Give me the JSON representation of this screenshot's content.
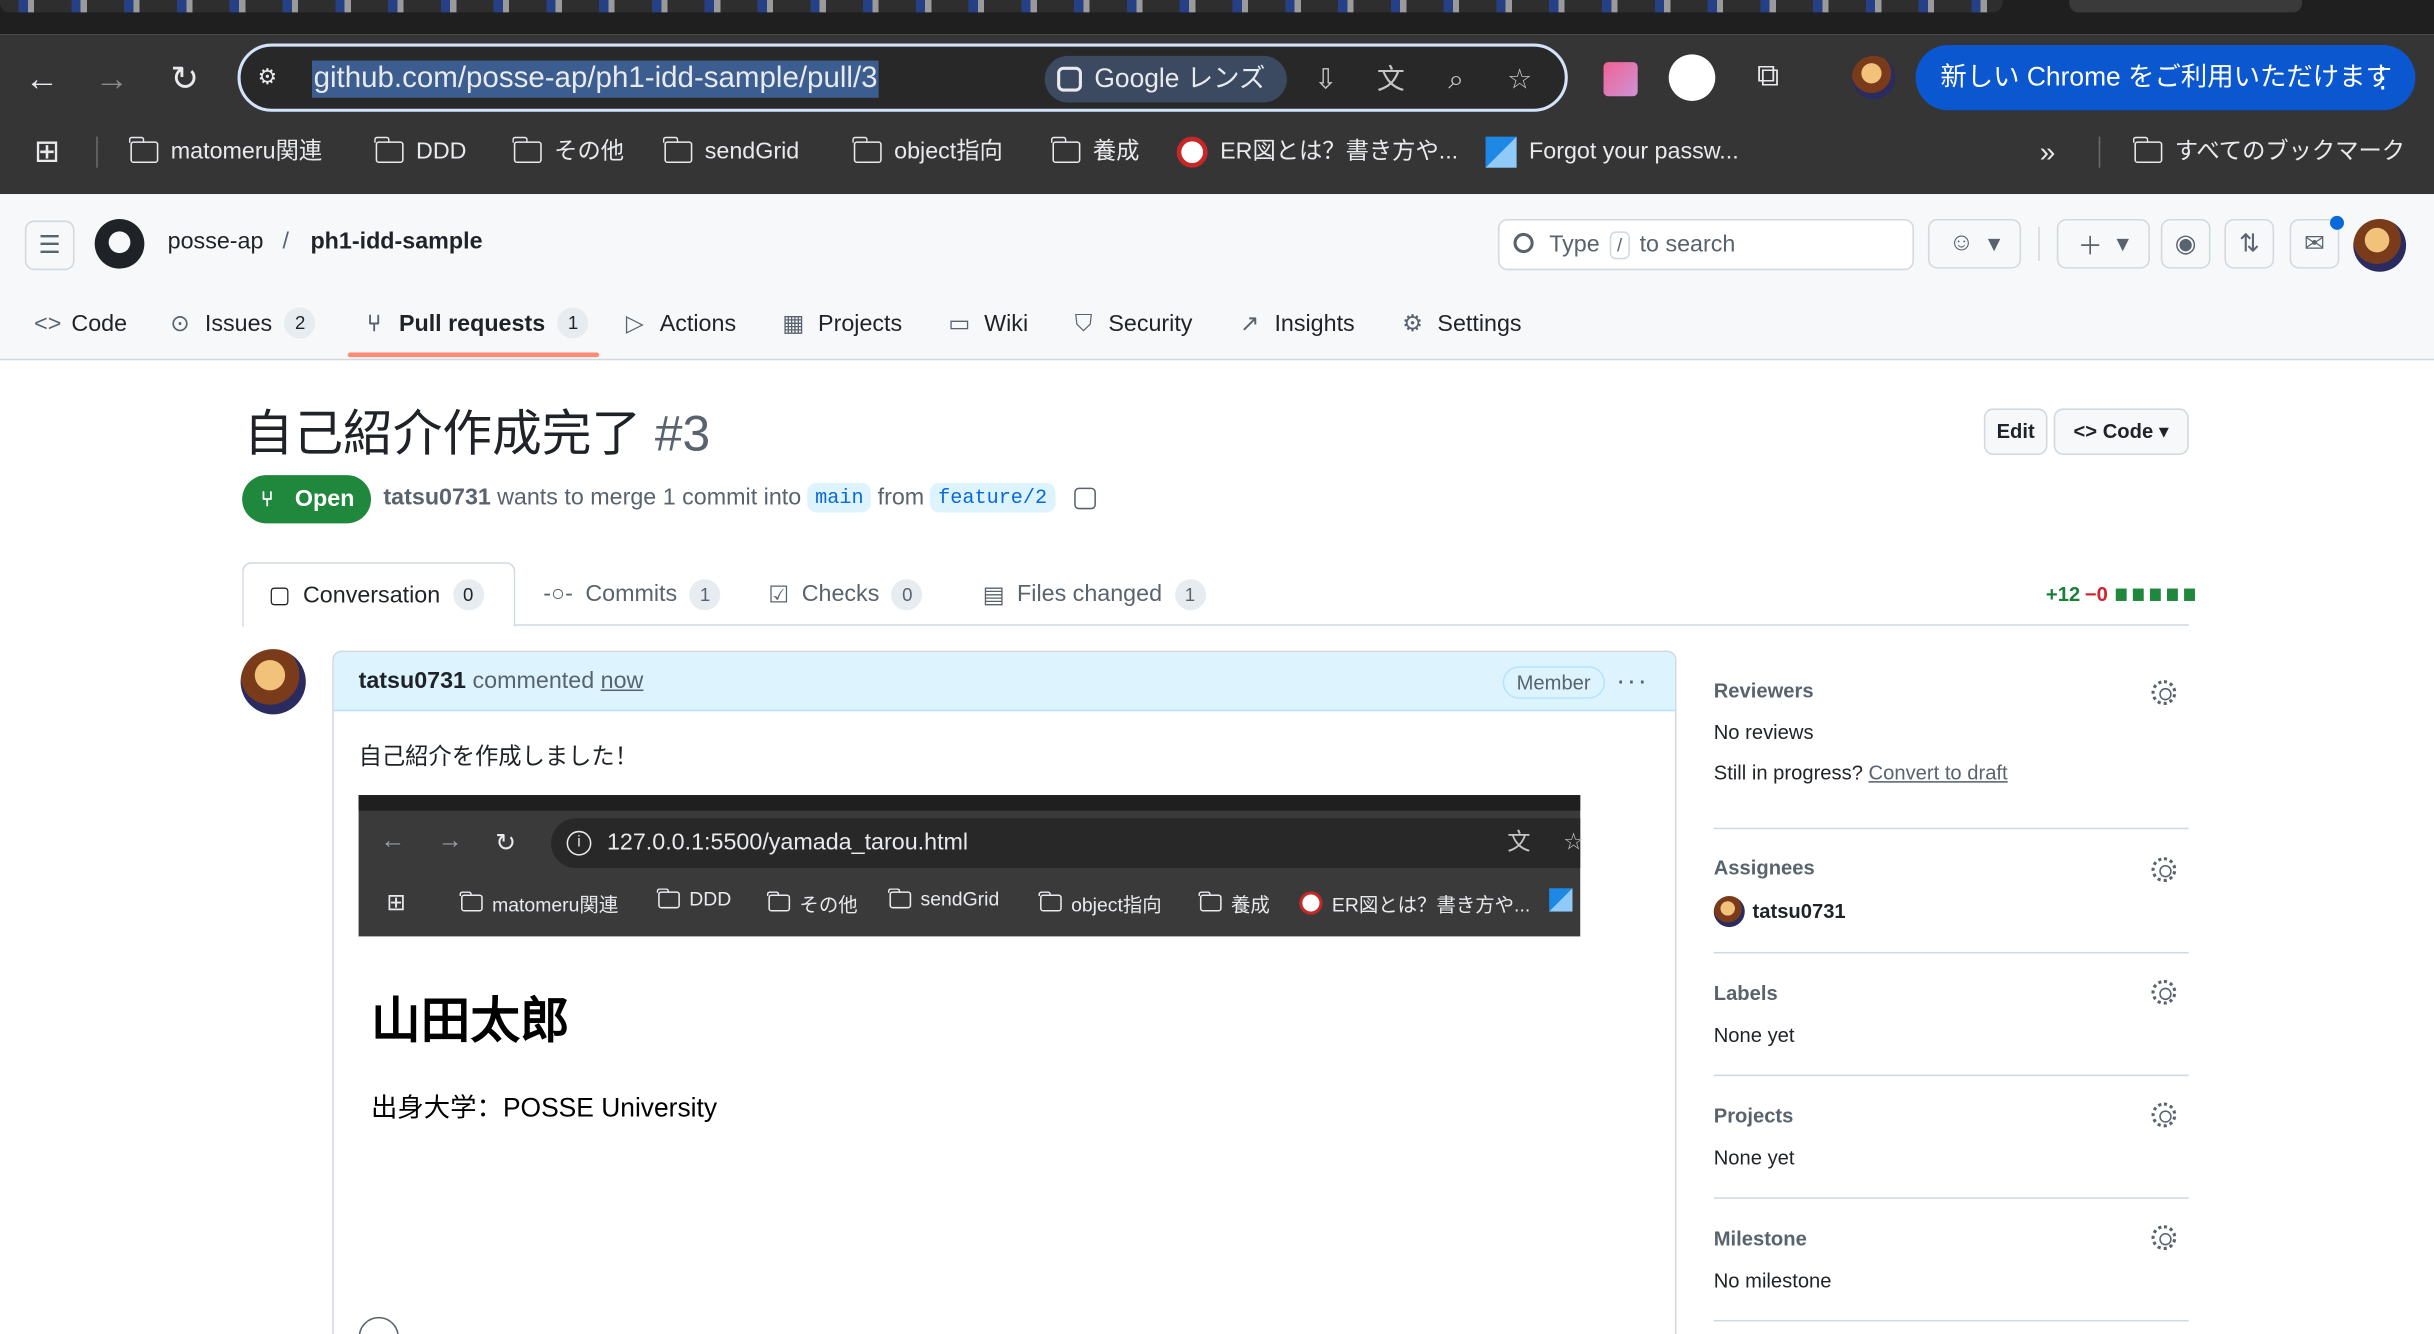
{
  "browser": {
    "url": "github.com/posse-ap/ph1-idd-sample/pull/3",
    "lens_label": "Google レンズ",
    "promo_label": "新しい Chrome をご利用いただけます",
    "bookmarks": [
      "matomeru関連",
      "DDD",
      "その他",
      "sendGrid",
      "object指向",
      "養成",
      "ER図とは？書き方や...",
      "Forgot your passw..."
    ],
    "all_bookmarks_label": "すべてのブックマーク"
  },
  "header": {
    "owner": "posse-ap",
    "separator": "/",
    "repo": "ph1-idd-sample",
    "search_prefix": "Type",
    "search_key": "/",
    "search_suffix": "to search"
  },
  "repo_tabs": [
    {
      "label": "Code",
      "icon": "code-icon"
    },
    {
      "label": "Issues",
      "icon": "issue-icon",
      "count": "2"
    },
    {
      "label": "Pull requests",
      "icon": "pull-request-icon",
      "count": "1",
      "selected": true
    },
    {
      "label": "Actions",
      "icon": "play-icon"
    },
    {
      "label": "Projects",
      "icon": "table-icon"
    },
    {
      "label": "Wiki",
      "icon": "book-icon"
    },
    {
      "label": "Security",
      "icon": "shield-icon"
    },
    {
      "label": "Insights",
      "icon": "graph-icon"
    },
    {
      "label": "Settings",
      "icon": "gear-icon"
    }
  ],
  "pr": {
    "title": "自己紹介作成完了",
    "number": "#3",
    "edit_label": "Edit",
    "code_label": "Code",
    "state": "Open",
    "author": "tatsu0731",
    "merge_text": "wants to merge 1 commit into",
    "base_branch": "main",
    "from_text": "from",
    "head_branch": "feature/2",
    "additions": "+12",
    "deletions": "−0"
  },
  "pr_tabs": [
    {
      "label": "Conversation",
      "count": "0"
    },
    {
      "label": "Commits",
      "count": "1"
    },
    {
      "label": "Checks",
      "count": "0"
    },
    {
      "label": "Files changed",
      "count": "1"
    }
  ],
  "comment": {
    "author": "tatsu0731",
    "action": "commented",
    "time": "now",
    "role": "Member",
    "body": "自己紹介を作成しました！",
    "screenshot": {
      "url": "127.0.0.1:5500/yamada_tarou.html",
      "bookmarks": [
        "matomeru関連",
        "DDD",
        "その他",
        "sendGrid",
        "object指向",
        "養成",
        "ER図とは？書き方や..."
      ],
      "heading": "山田太郎",
      "paragraph": "出身大学：POSSE University"
    }
  },
  "sidebar": {
    "reviewers_title": "Reviewers",
    "reviewers_value": "No reviews",
    "draft_prompt": "Still in progress?",
    "draft_link": "Convert to draft",
    "assignees_title": "Assignees",
    "assignee": "tatsu0731",
    "labels_title": "Labels",
    "labels_value": "None yet",
    "projects_title": "Projects",
    "projects_value": "None yet",
    "milestone_title": "Milestone",
    "milestone_value": "No milestone"
  },
  "colors": {
    "open_green": "#1f883d",
    "accent_blue": "#0969da",
    "underline_orange": "#fd8c73"
  }
}
